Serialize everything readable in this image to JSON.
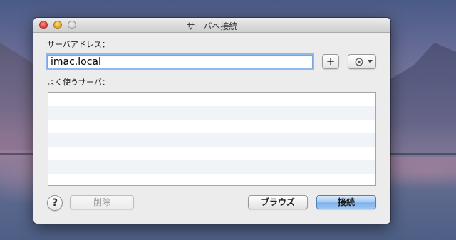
{
  "window": {
    "title": "サーバへ接続"
  },
  "form": {
    "address_label": "サーバアドレス：",
    "address_value": "imac.local",
    "add_button_label": "+",
    "favorites_label": "よく使うサーバ："
  },
  "favorites": {
    "items": []
  },
  "footer": {
    "help_label": "?",
    "delete_label": "削除",
    "browse_label": "ブラウズ",
    "connect_label": "接続"
  },
  "icons": {
    "action_menu": "gear-icon",
    "dropdown": "chevron-down-icon",
    "help": "question-icon"
  },
  "colors": {
    "accent": "#7fb1ec",
    "focus_ring": "#8fb9ee",
    "close": "#e2453a",
    "minimize": "#e6a92c",
    "zoom": "#cfcfcf"
  }
}
